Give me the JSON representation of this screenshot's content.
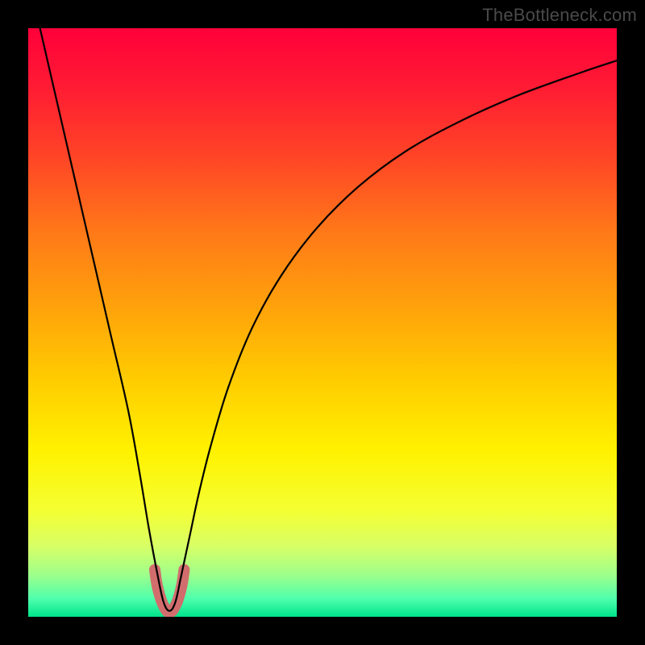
{
  "watermark": "TheBottleneck.com",
  "chart_data": {
    "type": "line",
    "title": "",
    "xlabel": "",
    "ylabel": "",
    "xlim": [
      0,
      100
    ],
    "ylim": [
      0,
      100
    ],
    "x_null": 24,
    "series": [
      {
        "name": "curve",
        "x": [
          2,
          5,
          8,
          11,
          14,
          17,
          19,
          20.5,
          22,
          23,
          24,
          25,
          26,
          27.5,
          29,
          31,
          34,
          38,
          43,
          49,
          56,
          64,
          73,
          83,
          94,
          100
        ],
        "values": [
          100,
          87,
          74,
          61,
          48,
          35,
          24,
          15,
          7,
          2.5,
          1,
          2.5,
          7,
          14,
          21,
          29,
          39,
          49,
          58,
          66,
          73,
          79,
          84,
          88.5,
          92.5,
          94.5
        ]
      }
    ],
    "marker_band": {
      "x_start": 21.5,
      "x_end": 26.5,
      "y_min": 1,
      "y_max": 8,
      "color": "#d16d6d"
    },
    "gradient_stops": [
      {
        "offset": 0.0,
        "color": "#ff003a"
      },
      {
        "offset": 0.1,
        "color": "#ff1b33"
      },
      {
        "offset": 0.22,
        "color": "#ff4526"
      },
      {
        "offset": 0.35,
        "color": "#ff7a18"
      },
      {
        "offset": 0.48,
        "color": "#ffa40a"
      },
      {
        "offset": 0.6,
        "color": "#ffcd00"
      },
      {
        "offset": 0.72,
        "color": "#fff200"
      },
      {
        "offset": 0.82,
        "color": "#f4ff33"
      },
      {
        "offset": 0.88,
        "color": "#d8ff66"
      },
      {
        "offset": 0.93,
        "color": "#9cff8c"
      },
      {
        "offset": 0.97,
        "color": "#4dffad"
      },
      {
        "offset": 1.0,
        "color": "#00e38a"
      }
    ]
  }
}
